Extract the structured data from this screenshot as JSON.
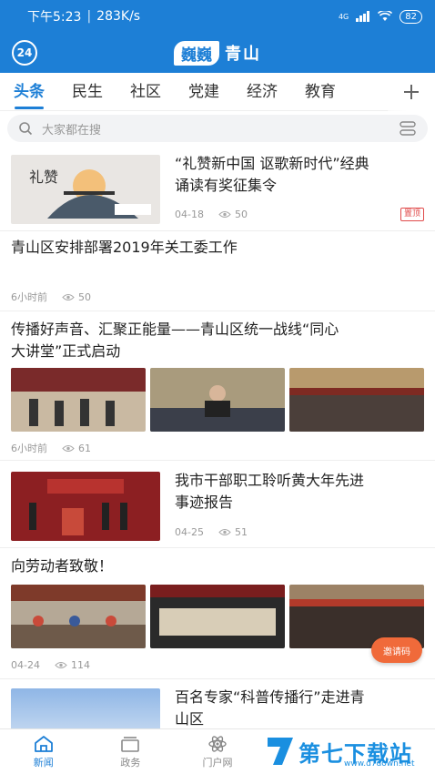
{
  "status_bar": {
    "time": "下午5:23",
    "speed": "283K/s",
    "network": "4G",
    "battery": "82"
  },
  "header": {
    "timer": "24",
    "brand": "巍巍",
    "city": "青山"
  },
  "tabs": [
    {
      "label": "头条"
    },
    {
      "label": "民生"
    },
    {
      "label": "社区"
    },
    {
      "label": "党建"
    },
    {
      "label": "经济"
    },
    {
      "label": "教育"
    }
  ],
  "search": {
    "placeholder": "大家都在搜"
  },
  "news": [
    {
      "title_l1": "“礼赞新中国 讴歌新时代”经典",
      "title_l2": "诵读有奖征集令",
      "date": "04-18",
      "views": "50",
      "badge": "置顶"
    },
    {
      "title": "青山区安排部署2019年关工委工作",
      "date": "6小时前",
      "views": "50"
    },
    {
      "title_l1": "传播好声音、汇聚正能量——青山区统一战线“同心",
      "title_l2": "大讲堂”正式启动",
      "date": "6小时前",
      "views": "61"
    },
    {
      "title_l1": "我市干部职工聆听黄大年先进",
      "title_l2": "事迹报告",
      "date": "04-25",
      "views": "51"
    },
    {
      "title": "向劳动者致敬！",
      "date": "04-24",
      "views": "114"
    },
    {
      "title_l1": "百名专家“科普传播行”走进青",
      "title_l2": "山区"
    }
  ],
  "invite": "邀请码",
  "bottom_nav": [
    {
      "label": "新闻"
    },
    {
      "label": "政务"
    },
    {
      "label": "门户网"
    },
    {
      "label": ""
    },
    {
      "label": ""
    }
  ],
  "watermark": {
    "main": "第七下载站",
    "url": "www.d7down.net"
  },
  "colors": {
    "brand_blue": "#1d7fd6",
    "badge_red": "#e04a4a",
    "invite_orange": "#f06a3a"
  }
}
